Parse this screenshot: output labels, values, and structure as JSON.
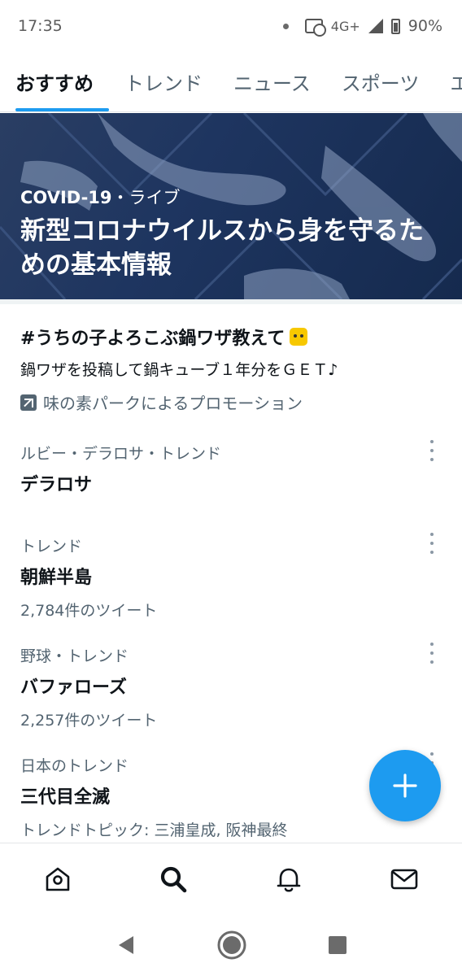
{
  "status_bar": {
    "time": "17:35",
    "network": "4G+",
    "battery": "90%"
  },
  "tabs": [
    {
      "label": "おすすめ",
      "active": true
    },
    {
      "label": "トレンド",
      "active": false
    },
    {
      "label": "ニュース",
      "active": false
    },
    {
      "label": "スポーツ",
      "active": false
    },
    {
      "label": "エ",
      "active": false
    }
  ],
  "hero": {
    "topic": "COVID-19",
    "live": "・ライブ",
    "title": "新型コロナウイルスから身を守るための基本情報"
  },
  "promo": {
    "title": "#うちの子よろこぶ鍋ワザ教えて",
    "description": "鍋ワザを投稿して鍋キューブ１年分をＧＥＴ♪",
    "promoted_by": "味の素パークによるプロモーション"
  },
  "trends": [
    {
      "meta": "ルビー・デラロサ・トレンド",
      "name": "デラロサ",
      "count": ""
    },
    {
      "meta": "トレンド",
      "name": "朝鮮半島",
      "count": "2,784件のツイート"
    },
    {
      "meta": "野球・トレンド",
      "name": "バファローズ",
      "count": "2,257件のツイート"
    },
    {
      "meta": "日本のトレンド",
      "name": "三代目全滅",
      "count": "トレンドトピック: 三浦皇成, 阪神最終"
    }
  ],
  "colors": {
    "accent": "#1d9bf0",
    "secondary_text": "#536471",
    "hero_background": "#1e3560"
  },
  "icons": {
    "fab": "plus-icon",
    "bottom_nav": [
      "home-icon",
      "search-icon",
      "bell-icon",
      "mail-icon"
    ],
    "system_nav": [
      "back-icon",
      "home-circle-icon",
      "recents-icon"
    ]
  }
}
